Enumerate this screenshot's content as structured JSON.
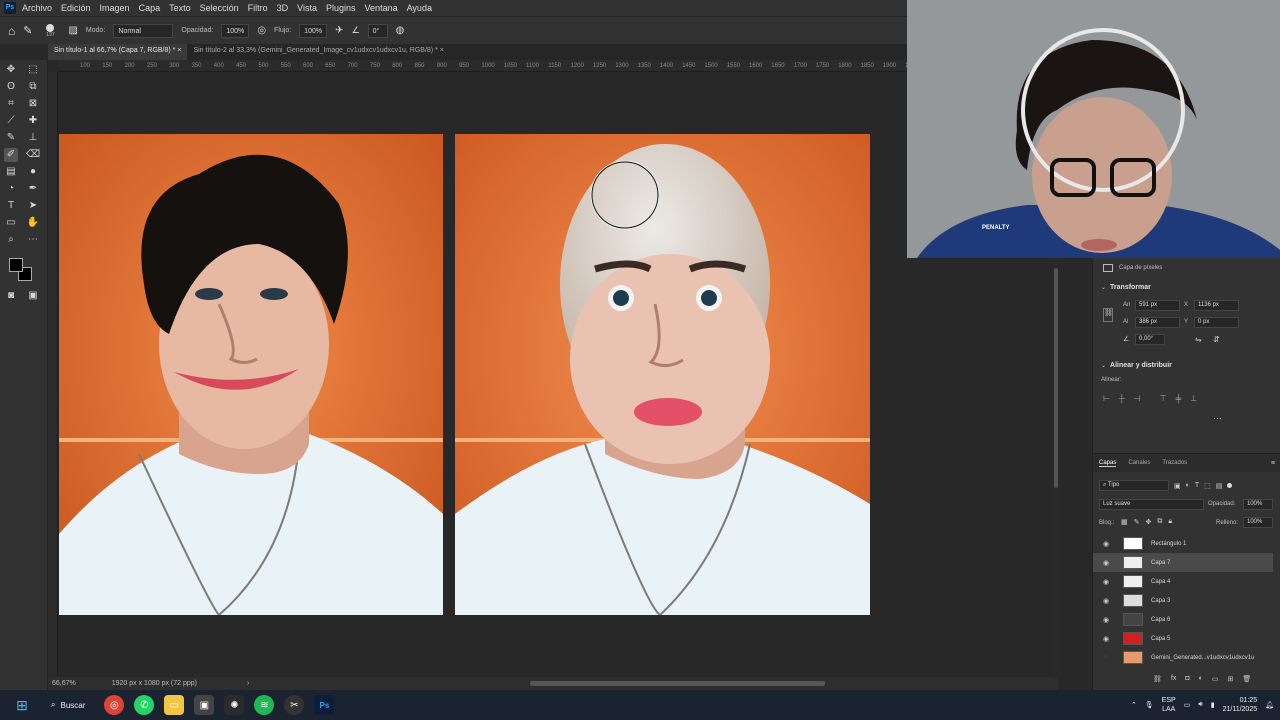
{
  "app": {
    "logo": "Ps"
  },
  "menu": [
    "Archivo",
    "Edición",
    "Imagen",
    "Capa",
    "Texto",
    "Selección",
    "Filtro",
    "3D",
    "Vista",
    "Plugins",
    "Ventana",
    "Ayuda"
  ],
  "options_bar": {
    "brush_size": "197",
    "mode_label": "Modo:",
    "mode_value": "Normal",
    "opacity_label": "Opacidad:",
    "opacity_value": "100%",
    "flow_label": "Flujo:",
    "flow_value": "100%",
    "angle_value": "0°"
  },
  "tabs": [
    {
      "label": "Sin título-1 al 66,7% (Capa 7, RGB/8) *",
      "active": true
    },
    {
      "label": "Sin título-2 al 33,3% (Gemini_Generated_Image_cv1udxcv1udxcv1u, RGB/8) *",
      "active": false
    }
  ],
  "ruler_ticks": [
    "100",
    "150",
    "200",
    "250",
    "300",
    "350",
    "400",
    "450",
    "500",
    "550",
    "600",
    "650",
    "700",
    "750",
    "800",
    "850",
    "900",
    "950",
    "1000",
    "1050",
    "1100",
    "1150",
    "1200",
    "1250",
    "1300",
    "1350",
    "1400",
    "1450",
    "1500",
    "1550",
    "1600",
    "1650",
    "1700",
    "1750",
    "1800",
    "1850",
    "1900",
    "1950"
  ],
  "status": {
    "zoom": "66,67%",
    "doc_info": "1920 px x 1080 px (72 ppp)"
  },
  "properties": {
    "layer_type": "Capa de píxeles",
    "transform_title": "Transformar",
    "w_label": "An",
    "w_value": "591 px",
    "x_label": "X",
    "x_value": "1136 px",
    "h_label": "Al",
    "h_value": "386 px",
    "y_label": "Y",
    "y_value": "0 px",
    "angle_value": "0,00°",
    "align_title": "Alinear y distribuir",
    "align_label": "Alinear:"
  },
  "layers_panel": {
    "tabs": [
      "Capas",
      "Canales",
      "Trazados"
    ],
    "filter": "Tipo",
    "blend_mode": "Luz suave",
    "opacity_label": "Opacidad:",
    "opacity_value": "100%",
    "lock_label": "Bloq.:",
    "fill_label": "Relleno:",
    "fill_value": "100%",
    "layers": [
      {
        "name": "Rectángulo 1",
        "selected": false,
        "thumb": "#ffffff"
      },
      {
        "name": "Capa 7",
        "selected": true,
        "thumb": "#eeeeee"
      },
      {
        "name": "Capa 4",
        "selected": false,
        "thumb": "#eeeeee"
      },
      {
        "name": "Capa 3",
        "selected": false,
        "thumb": "#dddddd"
      },
      {
        "name": "Capa 6",
        "selected": false,
        "thumb": "#444444"
      },
      {
        "name": "Capa 5",
        "selected": false,
        "thumb": "#d22020"
      },
      {
        "name": "Gemini_Generated...v1udxcv1udxcv1u",
        "selected": false,
        "thumb": "#e79a6a"
      }
    ]
  },
  "webcam": {
    "shirt_brand": "PENALTY"
  },
  "taskbar": {
    "search_label": "Buscar",
    "lang": "ESP",
    "lang_sub": "LAA",
    "time": "01:25",
    "date": "21/11/2025"
  },
  "colors": {
    "accent": "#31a8ff",
    "canvas_bg": "#e8763a",
    "shirt_blue": "#1e3a7a"
  }
}
